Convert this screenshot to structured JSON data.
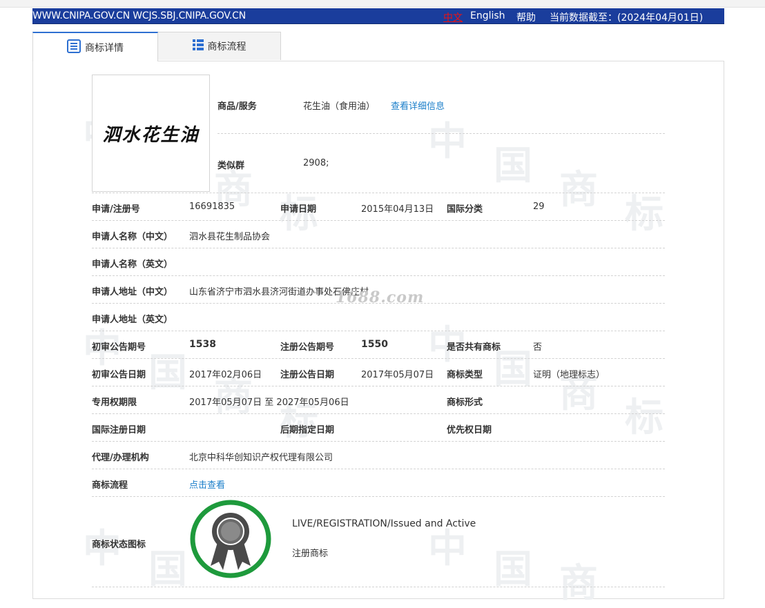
{
  "header": {
    "domains": "WWW.CNIPA.GOV.CN WCJS.SBJ.CNIPA.GOV.CN",
    "lang_zh": "中文",
    "lang_en": "English",
    "help": "帮助",
    "data_as_of": "当前数据截至：(2024年04月01日)"
  },
  "tabs": [
    {
      "label": "商标详情",
      "icon": "document-list-icon",
      "active": true
    },
    {
      "label": "商标流程",
      "icon": "grid-list-icon",
      "active": false
    }
  ],
  "mark_image_text": "泗水花生油",
  "goods": {
    "label": "商品/服务",
    "value": "花生油（食用油）",
    "detail_link": "查看详细信息"
  },
  "similar_group": {
    "label": "类似群",
    "value": "2908;"
  },
  "fields": {
    "reg_no_label": "申请/注册号",
    "reg_no": "16691835",
    "app_date_label": "申请日期",
    "app_date": "2015年04月13日",
    "intl_class_label": "国际分类",
    "intl_class": "29",
    "applicant_cn_label": "申请人名称（中文）",
    "applicant_cn": "泗水县花生制品协会",
    "applicant_en_label": "申请人名称（英文）",
    "applicant_en": "",
    "address_cn_label": "申请人地址（中文）",
    "address_cn": "山东省济宁市泗水县济河街道办事处石佛庄村",
    "address_en_label": "申请人地址（英文）",
    "address_en": "",
    "prelim_no_label": "初审公告期号",
    "prelim_no": "1538",
    "reg_pub_no_label": "注册公告期号",
    "reg_pub_no": "1550",
    "shared_label": "是否共有商标",
    "shared": "否",
    "prelim_date_label": "初审公告日期",
    "prelim_date": "2017年02月06日",
    "reg_pub_date_label": "注册公告日期",
    "reg_pub_date": "2017年05月07日",
    "mark_type_label": "商标类型",
    "mark_type": "证明（地理标志）",
    "exclusive_period_label": "专用权期限",
    "exclusive_period": "2017年05月07日 至 2027年05月06日",
    "mark_form_label": "商标形式",
    "mark_form": "",
    "intl_reg_date_label": "国际注册日期",
    "intl_reg_date": "",
    "later_designation_label": "后期指定日期",
    "later_designation": "",
    "priority_date_label": "优先权日期",
    "priority_date": "",
    "agent_label": "代理/办理机构",
    "agent": "北京中科华创知识产权代理有限公司",
    "process_label": "商标流程",
    "process_link": "点击查看",
    "status_icon_label": "商标状态图标",
    "status_en": "LIVE/REGISTRATION/Issued and Active",
    "status_cn": "注册商标"
  },
  "watermark_text": "1688.com",
  "colors": {
    "header_bg": "#1a3d9c",
    "link": "#1a7ec9",
    "seal_ring": "#1e9a3c",
    "seal_badge": "#4a4a4a"
  }
}
